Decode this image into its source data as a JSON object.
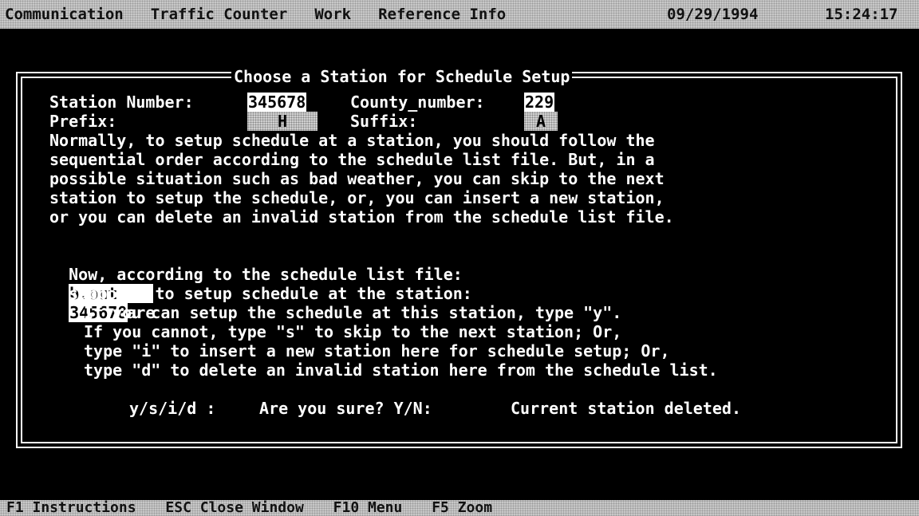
{
  "menubar": {
    "items": [
      "Communication",
      "Traffic Counter",
      "Work",
      "Reference Info"
    ],
    "date": "09/29/1994",
    "time": "15:24:17"
  },
  "dialog": {
    "title": "Choose a Station for Schedule Setup",
    "station_number_label": "Station Number:",
    "station_number_value": "345678",
    "county_number_label": "County_number:",
    "county_number_value": "229",
    "prefix_label": "Prefix:",
    "prefix_value": "H",
    "suffix_label": "Suffix:",
    "suffix_value": "A",
    "paragraph": [
      "Normally, to setup schedule at a station, you should follow the",
      "sequential order according to the schedule list file. But, in a",
      "possible situation such as bad weather, you can skip to the next",
      "station to setup the schedule, or, you can insert a new station,",
      "or you can delete an invalid station from the schedule list file."
    ],
    "now_prefix": "Now, according to the schedule list file:",
    "list_file_value": "b.out",
    "now_suffix": ", you are",
    "supposed_prefix": "supposed to setup schedule at the station:",
    "supposed_station": "345678",
    "instructions": [
      "If you can setup the schedule at this station, type \"y\".",
      "If you cannot, type \"s\" to skip to the next station; Or,",
      "type \"i\" to insert a new station here for schedule setup; Or,",
      "type \"d\" to delete an invalid station here from the schedule list."
    ],
    "prompt_choice": "y/s/i/d :",
    "prompt_confirm": "Are you sure? Y/N:",
    "prompt_result": "Current station deleted."
  },
  "statusbar": {
    "items": [
      "F1 Instructions",
      "ESC Close Window",
      "F10 Menu",
      "F5 Zoom"
    ]
  }
}
